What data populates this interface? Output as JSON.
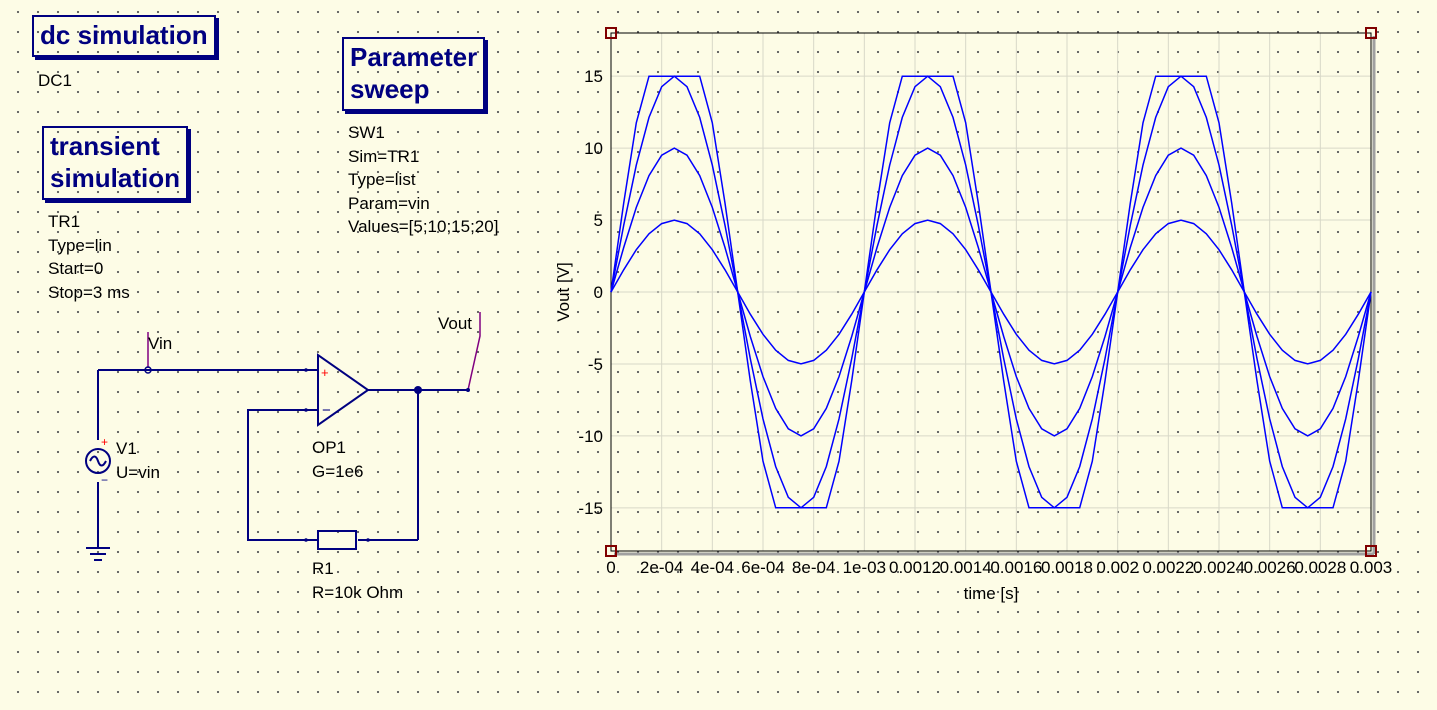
{
  "sim_boxes": {
    "dc": {
      "title": "dc simulation",
      "name": "DC1"
    },
    "transient": {
      "title_line1": "transient",
      "title_line2": "simulation",
      "params": [
        "TR1",
        "Type=lin",
        "Start=0",
        "Stop=3 ms"
      ]
    },
    "sweep": {
      "title_line1": "Parameter",
      "title_line2": "sweep",
      "params": [
        "SW1",
        "Sim=TR1",
        "Type=list",
        "Param=vin",
        "Values=[5;10;15;20]"
      ]
    }
  },
  "components": {
    "v1": {
      "name": "V1",
      "value": "U=vin"
    },
    "op1": {
      "name": "OP1",
      "value": "G=1e6"
    },
    "r1": {
      "name": "R1",
      "value": "R=10k Ohm"
    }
  },
  "nets": {
    "vin": "Vin",
    "vout": "Vout"
  },
  "chart_data": {
    "type": "line",
    "xlabel": "time [s]",
    "ylabel": "Vout [V]",
    "xlim": [
      0,
      0.003
    ],
    "ylim": [
      -18,
      18
    ],
    "x_tick_labels": [
      "0",
      "2e-04",
      "4e-04",
      "6e-04",
      "8e-04",
      "1e-03",
      "0.0012",
      "0.0014",
      "0.0016",
      "0.0018",
      "0.002",
      "0.0022",
      "0.0024",
      "0.0026",
      "0.0028",
      "0.003"
    ],
    "y_tick_labels": [
      "15",
      "10",
      "5",
      "0",
      "-5",
      "-10",
      "-15"
    ],
    "y_ticks": [
      15,
      10,
      5,
      0,
      -5,
      -10,
      -15
    ],
    "grid": true,
    "frequency_hz": 1000,
    "saturation": 15,
    "series": [
      {
        "amplitude": 5
      },
      {
        "amplitude": 10
      },
      {
        "amplitude": 15
      },
      {
        "amplitude": 20
      }
    ],
    "line_color": "#0000ff"
  }
}
